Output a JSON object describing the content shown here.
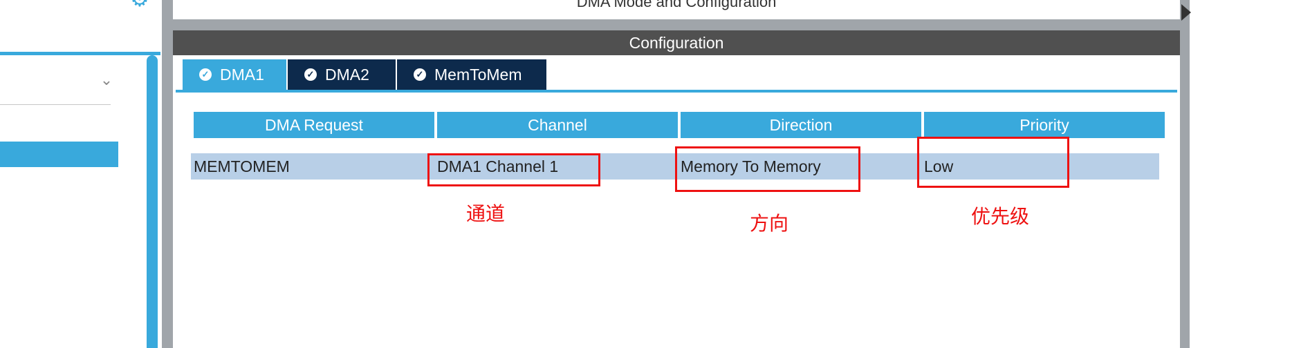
{
  "panel": {
    "mode_title": "DMA Mode and Configuration",
    "config_header": "Configuration"
  },
  "tabs": [
    {
      "label": "DMA1",
      "active": true
    },
    {
      "label": "DMA2",
      "active": false
    },
    {
      "label": "MemToMem",
      "active": false
    }
  ],
  "table": {
    "headers": [
      "DMA Request",
      "Channel",
      "Direction",
      "Priority"
    ],
    "rows": [
      [
        "MEMTOMEM",
        "DMA1 Channel 1",
        "Memory To Memory",
        "Low"
      ]
    ]
  },
  "annotations": {
    "channel": "通道",
    "direction": "方向",
    "priority": "优先级"
  },
  "icons": {
    "settings": "gear-icon",
    "dropdown": "chevron-down-icon",
    "tab_status": "check-circle-icon",
    "expand": "caret-right-icon"
  },
  "colors": {
    "accent": "#39a9dc",
    "header_dark": "#505050",
    "tab_inactive": "#0d2a4c",
    "row_selected": "#b8cfe7",
    "annotation_red": "#ee1111"
  }
}
